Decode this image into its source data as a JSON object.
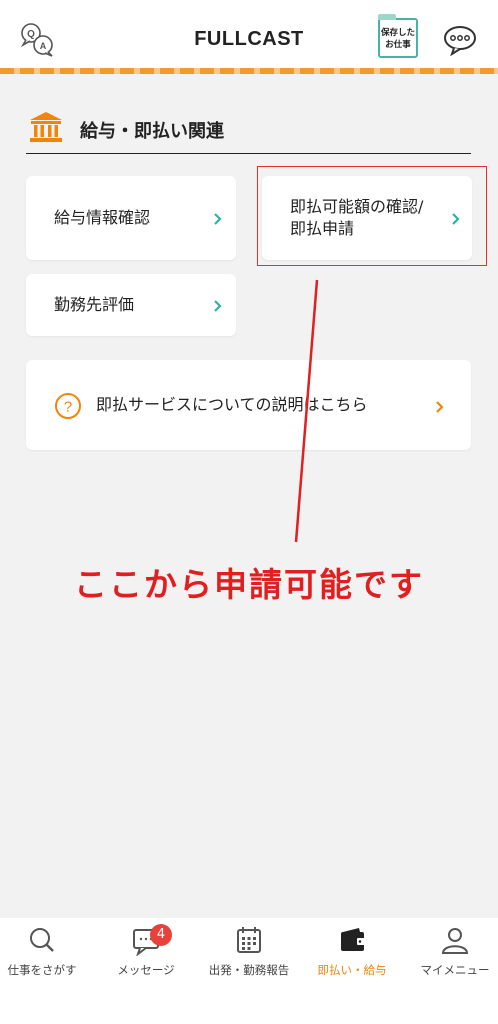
{
  "header": {
    "logo_text": "FULLCAST",
    "saved_jobs_line1": "保存した",
    "saved_jobs_line2": "お仕事"
  },
  "section": {
    "title": "給与・即払い関連"
  },
  "cards": {
    "salary_info": "給与情報確認",
    "instant_pay_line1": "即払可能額の確認/",
    "instant_pay_line2": "即払申請",
    "workplace_review": "勤務先評価",
    "service_info": "即払サービスについての説明はこちら"
  },
  "annotation": {
    "text": "ここから申請可能です"
  },
  "tabbar": {
    "items": [
      {
        "label": "仕事をさがす",
        "icon": "search-icon"
      },
      {
        "label": "メッセージ",
        "icon": "message-icon",
        "badge": "4"
      },
      {
        "label": "出発・勤務報告",
        "icon": "calendar-icon"
      },
      {
        "label": "即払い・給与",
        "icon": "wallet-icon",
        "active": true
      },
      {
        "label": "マイメニュー",
        "icon": "user-icon"
      }
    ]
  },
  "colors": {
    "accent_orange": "#f0850a",
    "teal": "#2bb3a4",
    "annotation_red": "#e02020",
    "badge_red": "#e8413c"
  }
}
